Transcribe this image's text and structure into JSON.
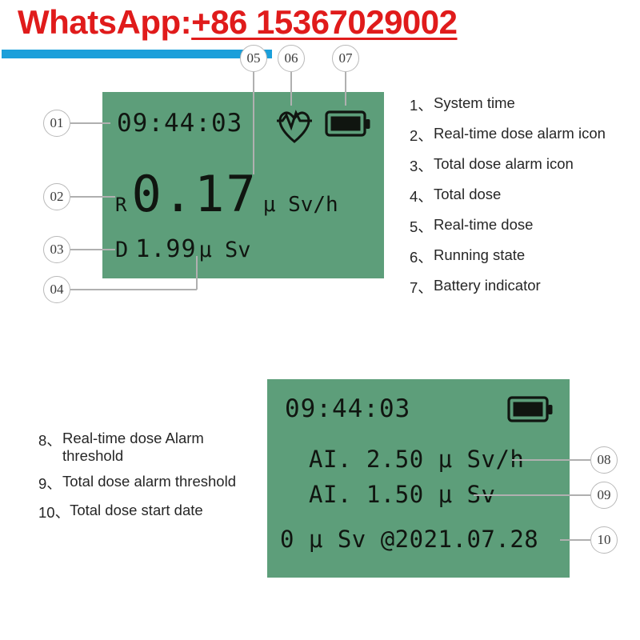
{
  "header": {
    "label_prefix": "WhatsApp:",
    "phone": "+86 15367029002",
    "text_color": "#e01b1b",
    "rule_color": "#1b9fda"
  },
  "lcd": {
    "background_color": "#5d9e7a",
    "text_color": "#101510",
    "main": {
      "time": "09:44:03",
      "rate_prefix": "R",
      "rate_value": "0.17",
      "rate_unit": "μ Sv/h",
      "dose_prefix": "D",
      "dose_value": "1.99",
      "dose_unit": "μ Sv",
      "running_icon": "heartbeat-icon",
      "battery_icon": "battery-full-icon"
    },
    "alarm": {
      "time": "09:44:03",
      "rate_alarm": "AI. 2.50 μ Sv/h",
      "dose_alarm": "AI. 1.50 μ Sv",
      "start_dose": "0 μ Sv  @2021.07.28",
      "battery_icon": "battery-full-icon"
    }
  },
  "callouts": {
    "c01": "01",
    "c02": "02",
    "c03": "03",
    "c04": "04",
    "c05": "05",
    "c06": "06",
    "c07": "07",
    "c08": "08",
    "c09": "09",
    "c10": "10"
  },
  "legend_top": [
    {
      "num": "1、",
      "text": "System time"
    },
    {
      "num": "2、",
      "text": "Real-time dose alarm icon"
    },
    {
      "num": "3、",
      "text": "Total dose alarm icon"
    },
    {
      "num": "4、",
      "text": "Total dose"
    },
    {
      "num": "5、",
      "text": "Real-time dose"
    },
    {
      "num": "6、",
      "text": "Running state"
    },
    {
      "num": "7、",
      "text": "Battery indicator"
    }
  ],
  "legend_bottom": [
    {
      "num": "8、",
      "text": "Real-time dose Alarm threshold"
    },
    {
      "num": "9、",
      "text": "Total dose alarm threshold"
    },
    {
      "num": "10、",
      "text": "Total dose start date"
    }
  ]
}
